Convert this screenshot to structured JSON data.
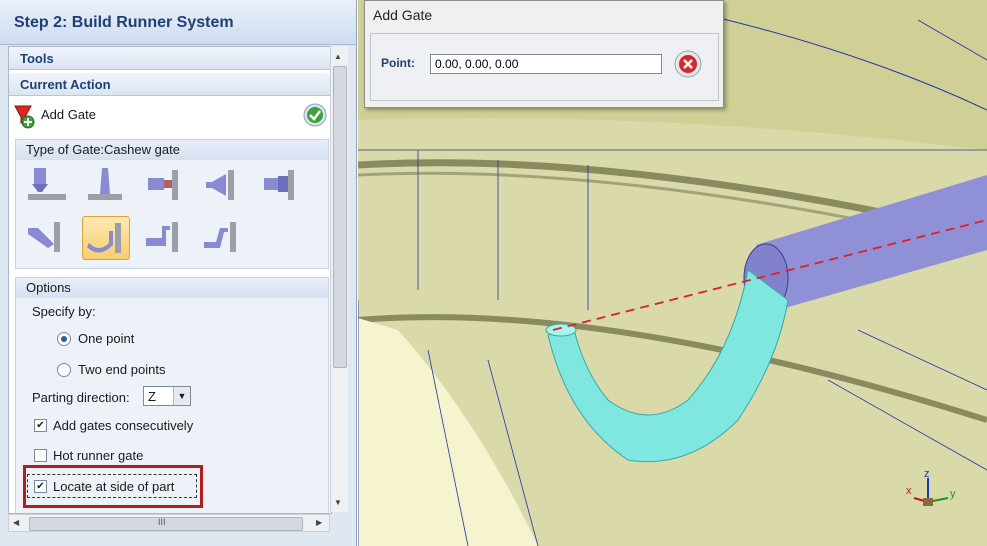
{
  "panel": {
    "title": "Step 2: Build Runner System",
    "tools_label": "Tools",
    "current_action_label": "Current Action",
    "action_name": "Add Gate",
    "gate_type_label": "Type of Gate:Cashew gate",
    "options_label": "Options",
    "specify_by_label": "Specify by:",
    "radio_one_point": "One point",
    "radio_two_end_points": "Two end points",
    "radio_selected": "One point",
    "parting_direction_label": "Parting direction:",
    "parting_direction_value": "Z",
    "checkboxes": [
      {
        "label": "Add gates consecutively",
        "checked": true
      },
      {
        "label": "Hot runner gate",
        "checked": false
      },
      {
        "label": "Locate at side of part",
        "checked": true
      }
    ],
    "hscroll_grip": "III"
  },
  "dialog": {
    "title": "Add Gate",
    "point_label": "Point:",
    "point_value": "0.00, 0.00, 0.00"
  },
  "axes": {
    "x": "x",
    "y": "y",
    "z": "z"
  },
  "colors": {
    "title_blue": "#1f3f78",
    "highlight_red": "#b01e1e",
    "gate_cyan": "#7fe6e0",
    "runner_purple": "#8f8fd8",
    "part_yellow": "#d6d6a4"
  }
}
